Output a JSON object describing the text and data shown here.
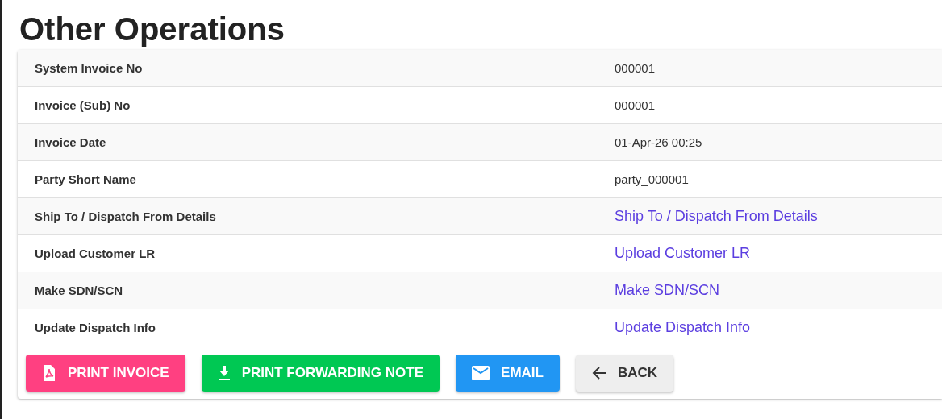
{
  "title": "Other Operations",
  "rows": [
    {
      "label": "System Invoice No",
      "value": "000001",
      "kind": "text"
    },
    {
      "label": "Invoice (Sub) No",
      "value": "000001",
      "kind": "text"
    },
    {
      "label": "Invoice Date",
      "value": "01-Apr-26 00:25",
      "kind": "text"
    },
    {
      "label": "Party Short Name",
      "value": "party_000001",
      "kind": "text"
    },
    {
      "label": "Ship To / Dispatch From Details",
      "value": "Ship To / Dispatch From Details",
      "kind": "link"
    },
    {
      "label": "Upload Customer LR",
      "value": "Upload Customer LR",
      "kind": "link"
    },
    {
      "label": "Make SDN/SCN",
      "value": "Make SDN/SCN",
      "kind": "link"
    },
    {
      "label": "Update Dispatch Info",
      "value": "Update Dispatch Info",
      "kind": "link"
    }
  ],
  "buttons": [
    {
      "label": "PRINT INVOICE",
      "kind": "pdf"
    },
    {
      "label": "PRINT FORWARDING NOTE",
      "kind": "download"
    },
    {
      "label": "EMAIL",
      "kind": "email"
    },
    {
      "label": "BACK",
      "kind": "back"
    }
  ]
}
